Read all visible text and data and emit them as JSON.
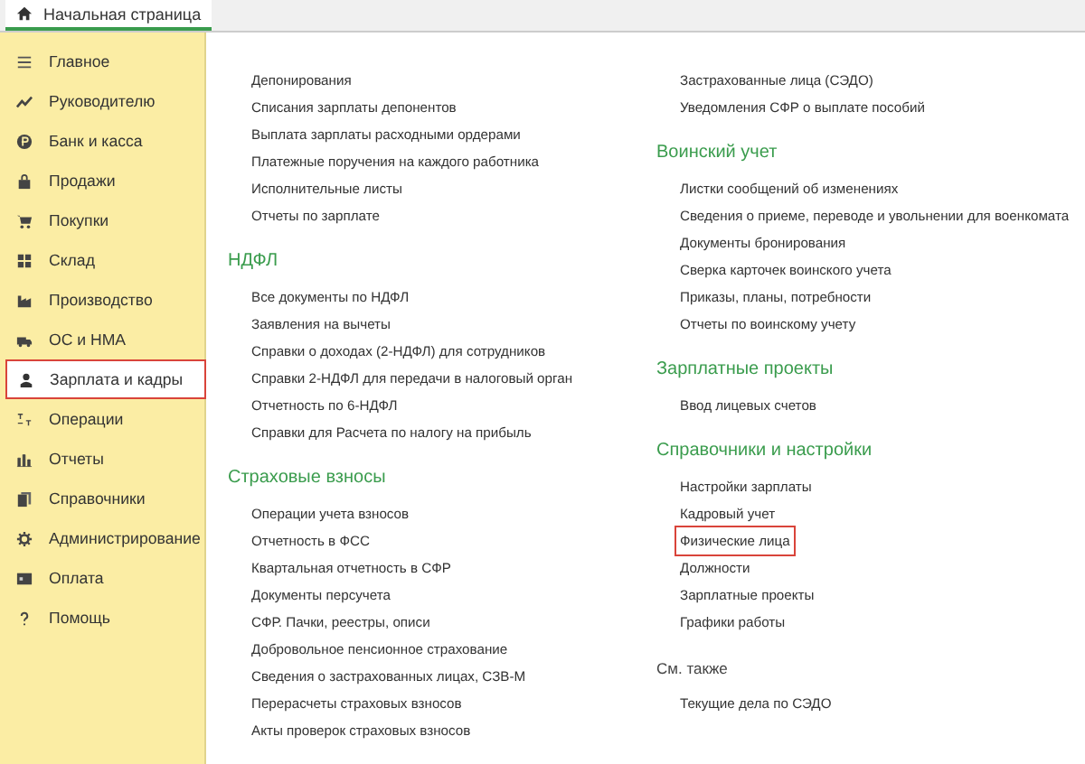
{
  "tabs": [
    {
      "label": "Начальная страница",
      "selected": true
    }
  ],
  "sidebar": {
    "items": [
      {
        "label": "Главное",
        "selected": false
      },
      {
        "label": "Руководителю",
        "selected": false
      },
      {
        "label": "Банк и касса",
        "selected": false
      },
      {
        "label": "Продажи",
        "selected": false
      },
      {
        "label": "Покупки",
        "selected": false
      },
      {
        "label": "Склад",
        "selected": false
      },
      {
        "label": "Производство",
        "selected": false
      },
      {
        "label": "ОС и НМА",
        "selected": false
      },
      {
        "label": "Зарплата и кадры",
        "selected": true
      },
      {
        "label": "Операции",
        "selected": false
      },
      {
        "label": "Отчеты",
        "selected": false
      },
      {
        "label": "Справочники",
        "selected": false
      },
      {
        "label": "Администрирование",
        "selected": false
      },
      {
        "label": "Оплата",
        "selected": false
      },
      {
        "label": "Помощь",
        "selected": false
      }
    ]
  },
  "columns": [
    [
      {
        "items": [
          {
            "label": "Депонирования",
            "highlighted": false
          },
          {
            "label": "Списания зарплаты депонентов",
            "highlighted": false
          },
          {
            "label": "Выплата зарплаты расходными ордерами",
            "highlighted": false
          },
          {
            "label": "Платежные поручения на каждого работника",
            "highlighted": false
          },
          {
            "label": "Исполнительные листы",
            "highlighted": false
          },
          {
            "label": "Отчеты по зарплате",
            "highlighted": false
          }
        ]
      },
      {
        "kind": "group",
        "heading": "НДФЛ",
        "items": [
          {
            "label": "Все документы по НДФЛ",
            "highlighted": false
          },
          {
            "label": "Заявления на вычеты",
            "highlighted": false
          },
          {
            "label": "Справки о доходах (2-НДФЛ) для сотрудников",
            "highlighted": false
          },
          {
            "label": "Справки 2-НДФЛ для передачи в налоговый орган",
            "highlighted": false
          },
          {
            "label": "Отчетность по 6-НДФЛ",
            "highlighted": false
          },
          {
            "label": "Справки для Расчета по налогу на прибыль",
            "highlighted": false
          }
        ]
      },
      {
        "kind": "group",
        "heading": "Страховые взносы",
        "items": [
          {
            "label": "Операции учета взносов",
            "highlighted": false
          },
          {
            "label": "Отчетность в ФСС",
            "highlighted": false
          },
          {
            "label": "Квартальная отчетность в СФР",
            "highlighted": false
          },
          {
            "label": "Документы персучета",
            "highlighted": false
          },
          {
            "label": "СФР. Пачки, реестры, описи",
            "highlighted": false
          },
          {
            "label": "Добровольное пенсионное страхование",
            "highlighted": false
          },
          {
            "label": "Сведения о застрахованных лицах, СЗВ-М",
            "highlighted": false
          },
          {
            "label": "Перерасчеты страховых взносов",
            "highlighted": false
          },
          {
            "label": "Акты проверок страховых взносов",
            "highlighted": false
          }
        ]
      }
    ],
    [
      {
        "items": [
          {
            "label": "Застрахованные лица (СЭДО)",
            "highlighted": false
          },
          {
            "label": "Уведомления СФР о выплате пособий",
            "highlighted": false
          }
        ]
      },
      {
        "kind": "group",
        "heading": "Воинский учет",
        "items": [
          {
            "label": "Листки сообщений об изменениях",
            "highlighted": false
          },
          {
            "label": "Сведения о приеме, переводе и увольнении для военкомата",
            "highlighted": false
          },
          {
            "label": "Документы бронирования",
            "highlighted": false
          },
          {
            "label": "Сверка карточек воинского учета",
            "highlighted": false
          },
          {
            "label": "Приказы, планы, потребности",
            "highlighted": false
          },
          {
            "label": "Отчеты по воинскому учету",
            "highlighted": false
          }
        ]
      },
      {
        "kind": "group",
        "heading": "Зарплатные проекты",
        "items": [
          {
            "label": "Ввод лицевых счетов",
            "highlighted": false
          }
        ]
      },
      {
        "kind": "group",
        "heading": "Справочники и настройки",
        "items": [
          {
            "label": "Настройки зарплаты",
            "highlighted": false
          },
          {
            "label": "Кадровый учет",
            "highlighted": false
          },
          {
            "label": "Физические лица",
            "highlighted": true
          },
          {
            "label": "Должности",
            "highlighted": false
          },
          {
            "label": "Зарплатные проекты",
            "highlighted": false
          },
          {
            "label": "Графики работы",
            "highlighted": false
          }
        ]
      },
      {
        "kind": "see_also",
        "heading": "См. также",
        "items": [
          {
            "label": "Текущие дела по СЭДО",
            "highlighted": false
          }
        ]
      }
    ]
  ]
}
